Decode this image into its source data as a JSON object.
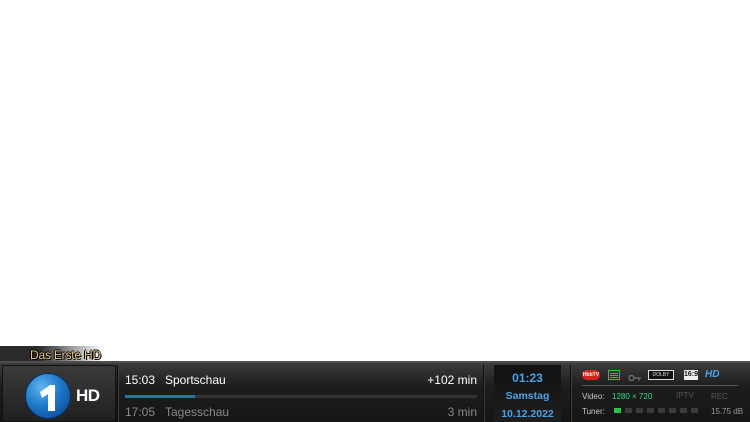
{
  "channel": {
    "name": "Das Erste HD",
    "logo_text": "HD",
    "logo_numeral": "1"
  },
  "epg": {
    "now": {
      "time": "15:03",
      "title": "Sportschau",
      "remaining": "+102 min",
      "progress": 0.2
    },
    "next": {
      "time": "17:05",
      "title": "Tagesschau",
      "duration": "3 min"
    }
  },
  "clock": {
    "time": "01:23",
    "day": "Samstag",
    "date": "10.12.2022"
  },
  "status": {
    "icons": [
      "hbbtv-icon",
      "subtitle-icon",
      "key-icon",
      "dolby-digital-icon",
      "aspect-16-9-icon",
      "hd-icon"
    ],
    "hbbtv_text": "HbbTV",
    "dolby_text": "DOLBY",
    "aspect_text": "16:9",
    "hd_text": "HD",
    "video_label": "Video:",
    "video_value": "1280 × 720",
    "iptv_label": "IPTV",
    "rec_label": "REC",
    "tuner_label": "Tuner:",
    "tuner_active_index": 0,
    "tuner_count": 8,
    "signal_value": "15.75 dB"
  },
  "colors": {
    "accent": "#4aa2e6",
    "channel_title": "#e8c98a",
    "video_value": "#3cd98a",
    "tuner_active": "#2fc24a",
    "hbbtv": "#d8231a"
  }
}
